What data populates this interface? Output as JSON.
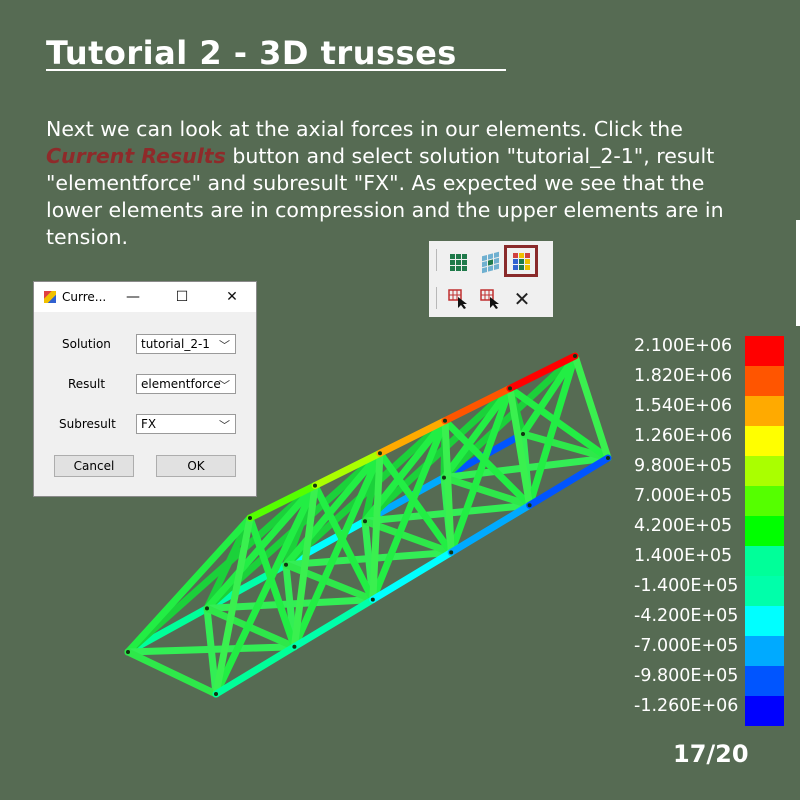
{
  "slide": {
    "title": "Tutorial 2 - 3D trusses",
    "intro_before": "Next we can look at the axial forces in our elements. Click the ",
    "intro_highlight": "Current Results",
    "intro_after": " button and select solution \"tutorial_2-1\", result \"elementforce\" and subresult \"FX\". As expected we see that the lower elements are in compression and the upper elements are in tension.",
    "page_number": "17/20"
  },
  "toolbar": {
    "row1": [
      "results-grid-icon",
      "deformed-grid-icon",
      "current-results-icon"
    ],
    "row2": [
      "select-elements-icon",
      "select-nodes-icon",
      "close-icon"
    ],
    "highlight_color": "#8a2a2a"
  },
  "dialog": {
    "title": "Curre...",
    "solution_label": "Solution",
    "solution_value": "tutorial_2-1",
    "result_label": "Result",
    "result_value": "elementforce",
    "subresult_label": "Subresult",
    "subresult_value": "FX",
    "cancel_label": "Cancel",
    "ok_label": "OK"
  },
  "legend": [
    {
      "label": "2.100E+06",
      "color": "#ff0000"
    },
    {
      "label": "1.820E+06",
      "color": "#ff5500"
    },
    {
      "label": "1.540E+06",
      "color": "#ffaa00"
    },
    {
      "label": "1.260E+06",
      "color": "#ffff00"
    },
    {
      "label": "9.800E+05",
      "color": "#aaff00"
    },
    {
      "label": "7.000E+05",
      "color": "#55ff00"
    },
    {
      "label": "4.200E+05",
      "color": "#00ff00"
    },
    {
      "label": "1.400E+05",
      "color": "#00ff99"
    },
    {
      "label": "-1.400E+05",
      "color": "#00ffaa"
    },
    {
      "label": "-4.200E+05",
      "color": "#00ffff"
    },
    {
      "label": "-7.000E+05",
      "color": "#00aaff"
    },
    {
      "label": "-9.800E+05",
      "color": "#0055ff"
    },
    {
      "label": "-1.260E+06",
      "color": "#0000ff"
    }
  ],
  "colors": {
    "background": "#566b53",
    "top_chord": [
      "#55ff00",
      "#aaff00",
      "#ffaa00",
      "#ff5500",
      "#ff0000"
    ],
    "bottom_chord": [
      "#00ff99",
      "#00ffaa",
      "#00ffff",
      "#00aaff",
      "#0055ff"
    ],
    "web": "#22ee44"
  }
}
